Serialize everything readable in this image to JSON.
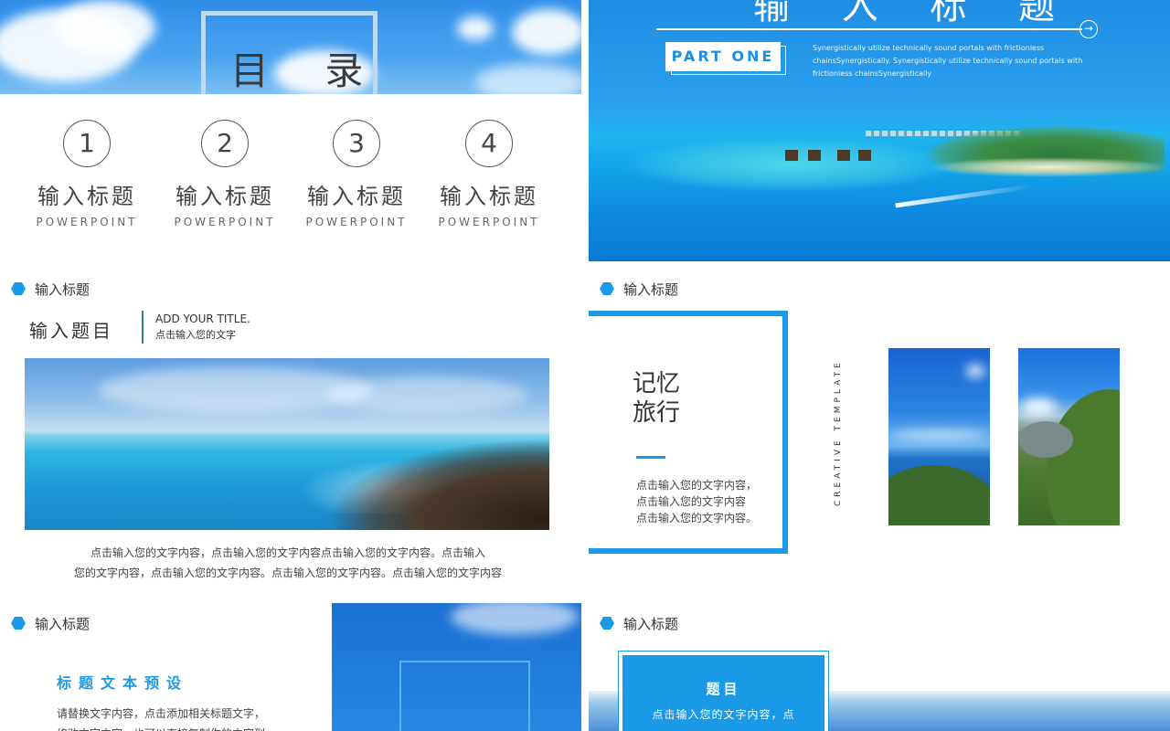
{
  "colors": {
    "accent": "#1a9ae6",
    "text": "#333333"
  },
  "slide1": {
    "title": "目 录",
    "items": [
      {
        "num": "1",
        "label": "输入标题",
        "sub": "POWERPOINT"
      },
      {
        "num": "2",
        "label": "输入标题",
        "sub": "POWERPOINT"
      },
      {
        "num": "3",
        "label": "输入标题",
        "sub": "POWERPOINT"
      },
      {
        "num": "4",
        "label": "输入标题",
        "sub": "POWERPOINT"
      }
    ]
  },
  "slide2": {
    "title": "输 入 标 题",
    "arrow": "→",
    "part": "PART ONE",
    "desc_line1": "Synergistically utilize technically sound portals with frictionless",
    "desc_line2": "chainsSynergistically. Synergistically utilize technically sound portals with",
    "desc_line3": "frictionless chainsSynergistically"
  },
  "slide3": {
    "section": "输入标题",
    "heading": "输入题目",
    "heading_en": "ADD YOUR TITLE.",
    "heading_cn": "点击输入您的文字",
    "body_line1": "点击输入您的文字内容，点击输入您的文字内容点击输入您的文字内容。点击输入",
    "body_line2": "您的文字内容，点击输入您的文字内容。点击输入您的文字内容。点击输入您的文字内容"
  },
  "slide4": {
    "section": "输入标题",
    "title_line1": "记忆",
    "title_line2": "旅行",
    "body_line1": "点击输入您的文字内容，",
    "body_line2": "点击输入您的文字内容",
    "body_line3": "点击输入您的文字内容。",
    "vertical": "CREATIVE TEMPLATE"
  },
  "slide5": {
    "section": "输入标题",
    "subhead": "标题文本预设",
    "para_line1": "请替换文字内容，点击添加相关标题文字，",
    "para_line2": "修改文字内容，也可以直接复制你的内容到"
  },
  "slide6": {
    "section": "输入标题",
    "card_title": "题目",
    "card_body": "点击输入您的文字内容，点"
  }
}
